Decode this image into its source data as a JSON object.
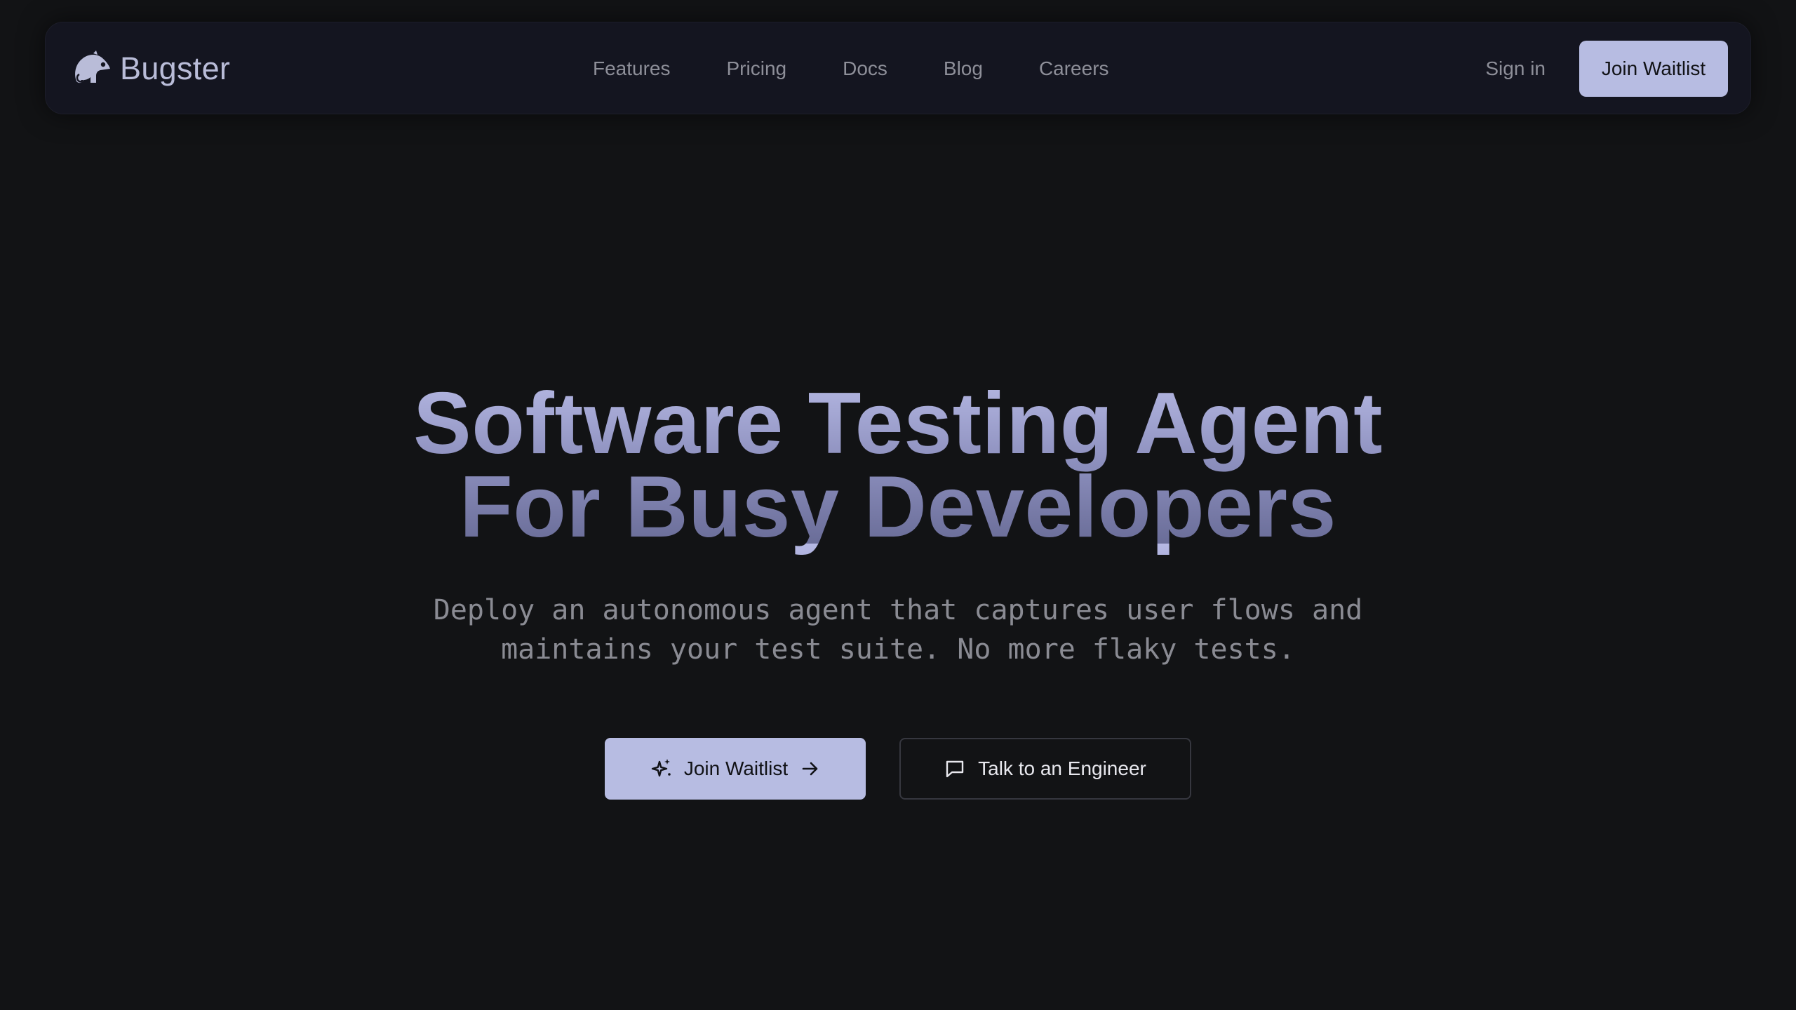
{
  "brand": {
    "name": "Bugster",
    "logo_icon": "chameleon-icon"
  },
  "nav": {
    "links": [
      {
        "label": "Features"
      },
      {
        "label": "Pricing"
      },
      {
        "label": "Docs"
      },
      {
        "label": "Blog"
      },
      {
        "label": "Careers"
      }
    ],
    "sign_in": "Sign in",
    "cta": "Join Waitlist"
  },
  "hero": {
    "title_line1": "Software Testing Agent",
    "title_line2": "For Busy Developers",
    "subtitle_line1": "Deploy an autonomous agent that captures user flows and",
    "subtitle_line2": "maintains your test suite. No more flaky tests.",
    "primary_cta": {
      "label": "Join Waitlist",
      "icon_left": "sparkle-icon",
      "icon_right": "arrow-right-icon"
    },
    "secondary_cta": {
      "label": "Talk to an Engineer",
      "icon_left": "chat-bubble-icon"
    }
  },
  "colors": {
    "background": "#121315",
    "navbar_bg": "#141520",
    "accent": "#b7bce2",
    "muted_text": "#8e8f99"
  }
}
